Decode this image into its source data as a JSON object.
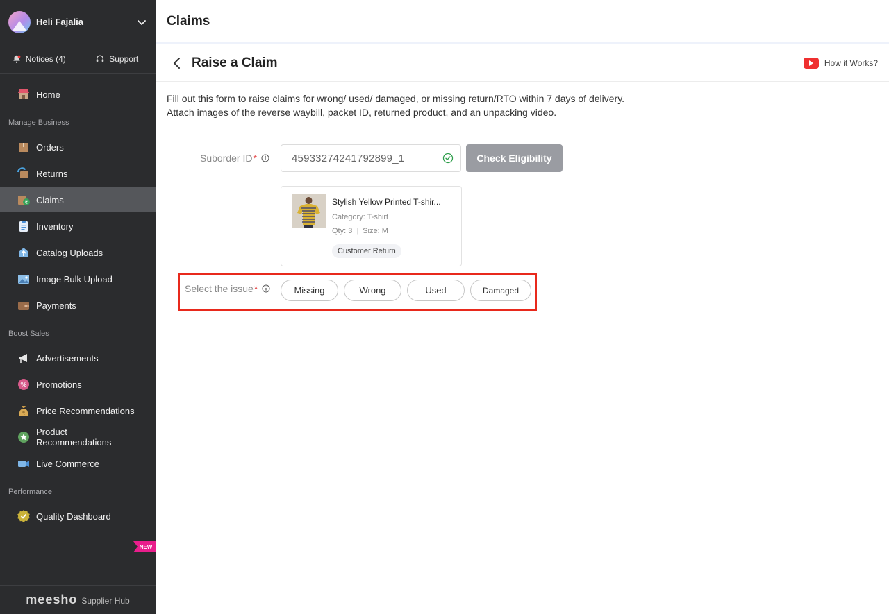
{
  "sidebar": {
    "user_name": "Heli Fajalia",
    "notices_label": "Notices (4)",
    "support_label": "Support",
    "home_label": "Home",
    "sections": {
      "manage": "Manage Business",
      "boost": "Boost Sales",
      "performance": "Performance"
    },
    "items": {
      "orders": "Orders",
      "returns": "Returns",
      "claims": "Claims",
      "inventory": "Inventory",
      "catalog": "Catalog Uploads",
      "image_bulk": "Image Bulk Upload",
      "payments": "Payments",
      "ads": "Advertisements",
      "promotions": "Promotions",
      "price_rec": "Price Recommendations",
      "product_rec": "Product Recommendations",
      "live": "Live Commerce",
      "quality": "Quality Dashboard"
    },
    "new_badge": "NEW",
    "brand": "meesho",
    "brand_sub": "Supplier Hub"
  },
  "header": {
    "title": "Claims"
  },
  "subheader": {
    "title": "Raise a Claim",
    "how_it_works": "How it Works?"
  },
  "form": {
    "description": "Fill out this form to raise  claims for wrong/ used/ damaged, or missing return/RTO within 7 days of delivery. Attach images of the reverse waybill, packet ID, returned product, and an unpacking video.",
    "suborder_label": "Suborder ID",
    "required_mark": "*",
    "suborder_value": "45933274241792899_1",
    "check_button": "Check Eligibility",
    "product": {
      "title": "Stylish Yellow Printed T-shir...",
      "category": "Category: T-shirt",
      "qty": "Qty: 3",
      "size": "Size: M",
      "badge": "Customer Return"
    },
    "issue_label": "Select the issue",
    "issues": [
      "Missing",
      "Wrong",
      "Used",
      "Damaged"
    ]
  },
  "colors": {
    "sidebar_bg": "#2b2c2e",
    "active_item": "#55575b",
    "highlight_box": "#e8291c",
    "button_disabled": "#9a9ca2",
    "new_badge": "#e91e8c"
  }
}
